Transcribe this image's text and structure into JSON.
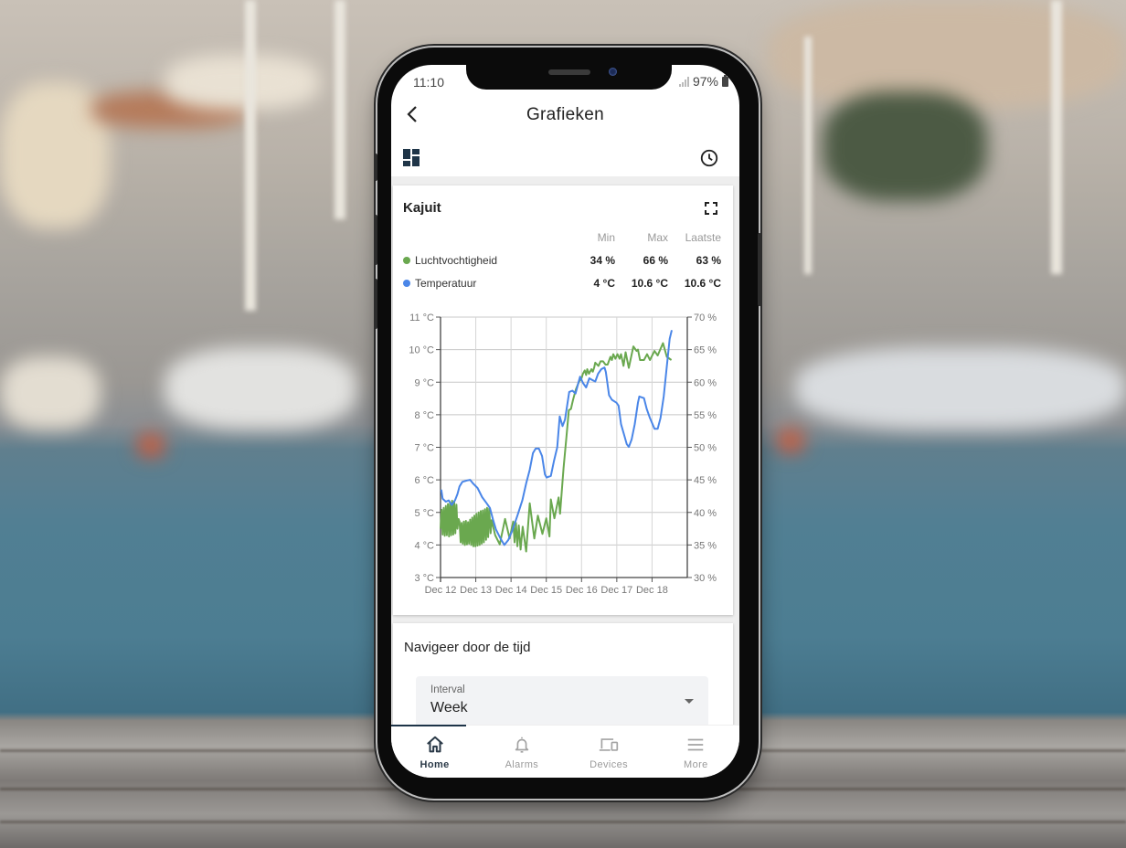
{
  "status_bar": {
    "time": "11:10",
    "battery": "97%"
  },
  "app_bar": {
    "title": "Grafieken",
    "back_icon": "chevron-left-icon"
  },
  "toolbar": {
    "left_icon": "dashboard-icon",
    "right_icon": "clock-icon"
  },
  "card": {
    "title": "Kajuit",
    "fullscreen_icon": "fullscreen-icon",
    "columns": [
      "Min",
      "Max",
      "Laatste"
    ],
    "rows": [
      {
        "name": "Luchtvochtigheid",
        "color": "#6aa84f",
        "min": "34 %",
        "max": "66 %",
        "last": "63 %"
      },
      {
        "name": "Temperatuur",
        "color": "#4a86e8",
        "min": "4 °C",
        "max": "10.6 °C",
        "last": "10.6 °C"
      }
    ]
  },
  "chart_data": {
    "type": "line",
    "title": "Kajuit",
    "x_labels": [
      "Dec 12",
      "Dec 13",
      "Dec 14",
      "Dec 15",
      "Dec 16",
      "Dec 17",
      "Dec 18"
    ],
    "x_unit": "days since Dec 12",
    "xlim": [
      0,
      7
    ],
    "y_left": {
      "label": "Temperatuur",
      "unit": "°C",
      "ylim": [
        3,
        11
      ],
      "ticks": [
        "11 °C",
        "10 °C",
        "9 °C",
        "8 °C",
        "7 °C",
        "6 °C",
        "5 °C",
        "4 °C",
        "3 °C"
      ]
    },
    "y_right": {
      "label": "Luchtvochtigheid",
      "unit": "%",
      "ylim": [
        30,
        70
      ],
      "ticks": [
        "70 %",
        "65 %",
        "60 %",
        "55 %",
        "50 %",
        "45 %",
        "40 %",
        "35 %",
        "30 %"
      ]
    },
    "grid": true,
    "legend": "none",
    "series": [
      {
        "name": "Temperatuur",
        "axis": "left",
        "color": "#4a86e8",
        "points": [
          [
            0.02,
            5.7
          ],
          [
            0.06,
            5.42
          ],
          [
            0.15,
            5.33
          ],
          [
            0.23,
            5.37
          ],
          [
            0.32,
            5.23
          ],
          [
            0.41,
            5.37
          ],
          [
            0.48,
            5.56
          ],
          [
            0.54,
            5.8
          ],
          [
            0.62,
            5.94
          ],
          [
            0.75,
            5.98
          ],
          [
            0.84,
            6.0
          ],
          [
            0.92,
            5.89
          ],
          [
            1.05,
            5.75
          ],
          [
            1.18,
            5.47
          ],
          [
            1.31,
            5.28
          ],
          [
            1.4,
            5.14
          ],
          [
            1.49,
            4.77
          ],
          [
            1.57,
            4.48
          ],
          [
            1.7,
            4.2
          ],
          [
            1.81,
            4.0
          ],
          [
            1.92,
            4.15
          ],
          [
            2.03,
            4.43
          ],
          [
            2.18,
            4.9
          ],
          [
            2.32,
            5.37
          ],
          [
            2.43,
            5.89
          ],
          [
            2.53,
            6.31
          ],
          [
            2.62,
            6.82
          ],
          [
            2.7,
            6.96
          ],
          [
            2.79,
            6.96
          ],
          [
            2.88,
            6.73
          ],
          [
            2.96,
            6.17
          ],
          [
            3.01,
            6.07
          ],
          [
            3.13,
            6.12
          ],
          [
            3.22,
            6.59
          ],
          [
            3.31,
            7.0
          ],
          [
            3.38,
            7.95
          ],
          [
            3.46,
            7.65
          ],
          [
            3.53,
            7.85
          ],
          [
            3.65,
            8.7
          ],
          [
            3.74,
            8.74
          ],
          [
            3.83,
            8.65
          ],
          [
            3.91,
            8.98
          ],
          [
            3.96,
            9.17
          ],
          [
            4.04,
            8.98
          ],
          [
            4.13,
            8.84
          ],
          [
            4.22,
            9.12
          ],
          [
            4.3,
            9.07
          ],
          [
            4.39,
            9.02
          ],
          [
            4.47,
            9.26
          ],
          [
            4.56,
            9.4
          ],
          [
            4.65,
            9.45
          ],
          [
            4.69,
            9.31
          ],
          [
            4.78,
            8.6
          ],
          [
            4.86,
            8.46
          ],
          [
            4.99,
            8.37
          ],
          [
            5.05,
            8.28
          ],
          [
            5.12,
            7.71
          ],
          [
            5.22,
            7.34
          ],
          [
            5.28,
            7.1
          ],
          [
            5.34,
            7.01
          ],
          [
            5.42,
            7.24
          ],
          [
            5.51,
            7.71
          ],
          [
            5.6,
            8.37
          ],
          [
            5.64,
            8.56
          ],
          [
            5.77,
            8.51
          ],
          [
            5.85,
            8.18
          ],
          [
            5.94,
            7.9
          ],
          [
            6.07,
            7.57
          ],
          [
            6.16,
            7.57
          ],
          [
            6.24,
            7.9
          ],
          [
            6.33,
            8.56
          ],
          [
            6.42,
            9.49
          ],
          [
            6.5,
            10.33
          ],
          [
            6.56,
            10.6
          ]
        ]
      },
      {
        "name": "Luchtvochtigheid",
        "axis": "right",
        "color": "#6aa84f",
        "points": [
          [
            0.0,
            37.5
          ],
          [
            0.03,
            40.4
          ],
          [
            0.06,
            36.6
          ],
          [
            0.09,
            40.7
          ],
          [
            0.12,
            36.4
          ],
          [
            0.15,
            41.0
          ],
          [
            0.18,
            36.5
          ],
          [
            0.21,
            41.3
          ],
          [
            0.24,
            36.3
          ],
          [
            0.27,
            41.5
          ],
          [
            0.3,
            36.5
          ],
          [
            0.33,
            41.8
          ],
          [
            0.36,
            36.6
          ],
          [
            0.39,
            41.6
          ],
          [
            0.42,
            36.8
          ],
          [
            0.45,
            41.2
          ],
          [
            0.48,
            37.5
          ],
          [
            0.51,
            39.0
          ],
          [
            0.54,
            38.6
          ],
          [
            0.57,
            35.4
          ],
          [
            0.6,
            38.4
          ],
          [
            0.63,
            35.2
          ],
          [
            0.66,
            38.6
          ],
          [
            0.69,
            35.0
          ],
          [
            0.72,
            38.7
          ],
          [
            0.75,
            35.1
          ],
          [
            0.78,
            38.5
          ],
          [
            0.81,
            35.2
          ],
          [
            0.84,
            38.9
          ],
          [
            0.87,
            35.0
          ],
          [
            0.9,
            39.2
          ],
          [
            0.93,
            34.8
          ],
          [
            0.96,
            39.5
          ],
          [
            0.99,
            34.8
          ],
          [
            1.02,
            39.8
          ],
          [
            1.05,
            34.9
          ],
          [
            1.08,
            40.0
          ],
          [
            1.11,
            35.0
          ],
          [
            1.14,
            40.2
          ],
          [
            1.17,
            35.2
          ],
          [
            1.2,
            40.3
          ],
          [
            1.23,
            35.4
          ],
          [
            1.26,
            40.5
          ],
          [
            1.29,
            35.8
          ],
          [
            1.32,
            40.7
          ],
          [
            1.35,
            36.2
          ],
          [
            1.38,
            40.6
          ],
          [
            1.42,
            36.8
          ],
          [
            1.45,
            38.8
          ],
          [
            1.55,
            36.5
          ],
          [
            1.68,
            35.1
          ],
          [
            1.83,
            39.0
          ],
          [
            1.96,
            36.0
          ],
          [
            2.06,
            38.6
          ],
          [
            2.1,
            35.4
          ],
          [
            2.14,
            38.4
          ],
          [
            2.18,
            34.8
          ],
          [
            2.22,
            38.0
          ],
          [
            2.27,
            34.3
          ],
          [
            2.33,
            37.8
          ],
          [
            2.43,
            34.0
          ],
          [
            2.53,
            41.4
          ],
          [
            2.66,
            36.0
          ],
          [
            2.76,
            39.5
          ],
          [
            2.89,
            36.7
          ],
          [
            3.0,
            39.1
          ],
          [
            3.09,
            36.3
          ],
          [
            3.13,
            42.0
          ],
          [
            3.23,
            39.1
          ],
          [
            3.35,
            42.3
          ],
          [
            3.39,
            39.8
          ],
          [
            3.49,
            46.8
          ],
          [
            3.57,
            51.5
          ],
          [
            3.64,
            55.7
          ],
          [
            3.7,
            55.9
          ],
          [
            3.76,
            57.3
          ],
          [
            3.84,
            58.9
          ],
          [
            3.93,
            60.1
          ],
          [
            4.0,
            60.6
          ],
          [
            4.04,
            61.3
          ],
          [
            4.09,
            61.8
          ],
          [
            4.13,
            61.1
          ],
          [
            4.16,
            62.0
          ],
          [
            4.21,
            61.3
          ],
          [
            4.28,
            62.0
          ],
          [
            4.32,
            61.6
          ],
          [
            4.36,
            62.3
          ],
          [
            4.39,
            63.0
          ],
          [
            4.48,
            62.5
          ],
          [
            4.54,
            63.2
          ],
          [
            4.61,
            63.2
          ],
          [
            4.68,
            62.7
          ],
          [
            4.74,
            62.7
          ],
          [
            4.82,
            63.9
          ],
          [
            4.86,
            63.4
          ],
          [
            4.9,
            64.3
          ],
          [
            4.96,
            63.6
          ],
          [
            5.02,
            64.3
          ],
          [
            5.08,
            63.6
          ],
          [
            5.12,
            64.3
          ],
          [
            5.19,
            62.5
          ],
          [
            5.25,
            64.6
          ],
          [
            5.34,
            62.2
          ],
          [
            5.47,
            65.5
          ],
          [
            5.56,
            64.8
          ],
          [
            5.6,
            65.0
          ],
          [
            5.66,
            63.4
          ],
          [
            5.77,
            63.4
          ],
          [
            5.86,
            64.3
          ],
          [
            5.94,
            63.4
          ],
          [
            6.07,
            64.8
          ],
          [
            6.16,
            64.1
          ],
          [
            6.31,
            66.0
          ],
          [
            6.42,
            63.9
          ],
          [
            6.55,
            63.4
          ]
        ]
      }
    ]
  },
  "navigate": {
    "title": "Navigeer door de tijd",
    "interval_label": "Interval",
    "interval_value": "Week"
  },
  "bottom_nav": {
    "active": "Home",
    "items": [
      {
        "label": "Home",
        "icon": "home-icon"
      },
      {
        "label": "Alarms",
        "icon": "bell-icon"
      },
      {
        "label": "Devices",
        "icon": "devices-icon"
      },
      {
        "label": "More",
        "icon": "menu-icon"
      }
    ]
  }
}
